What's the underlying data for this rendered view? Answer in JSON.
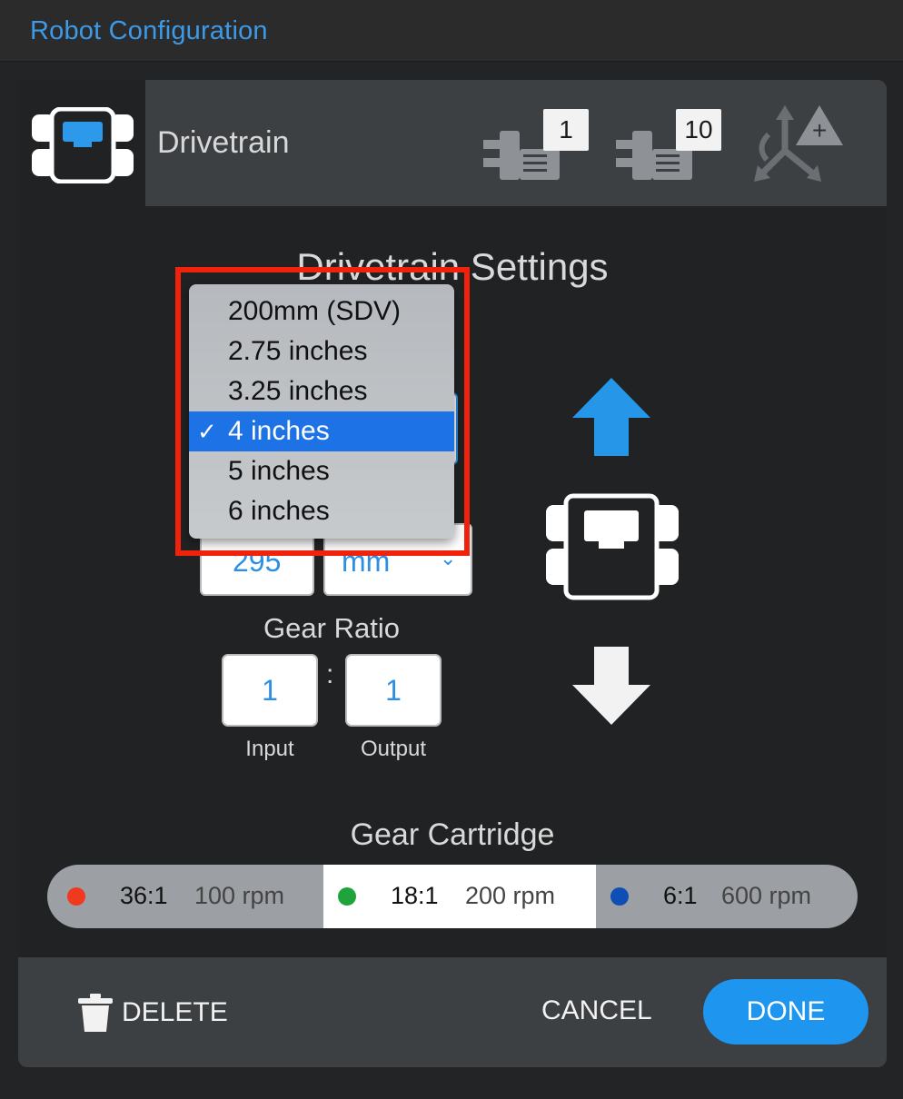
{
  "window": {
    "title": "Robot Configuration"
  },
  "header": {
    "device_label": "Drivetrain",
    "badges": [
      "1",
      "10",
      "+"
    ],
    "icons": [
      "drivetrain-icon",
      "motor-icon",
      "motor-group-icon",
      "inertial-sensor-icon"
    ]
  },
  "settings": {
    "title": "Drivetrain Settings",
    "wheel_size_options": [
      "200mm (SDV)",
      "2.75 inches",
      "3.25 inches",
      "4 inches",
      "5 inches",
      "6 inches"
    ],
    "wheel_size_selected": "4 inches",
    "selected_check": "✓",
    "wheelbase_value": "295",
    "wheelbase_unit": "mm",
    "gear_ratio": {
      "title": "Gear Ratio",
      "input_value": "1",
      "output_value": "1",
      "separator": ":",
      "input_caption": "Input",
      "output_caption": "Output"
    }
  },
  "cartridge": {
    "title": "Gear Cartridge",
    "options": [
      {
        "ratio": "36:1",
        "rpm": "100 rpm",
        "color": "#f0391e",
        "selected": false
      },
      {
        "ratio": "18:1",
        "rpm": "200 rpm",
        "color": "#1ea43a",
        "selected": true
      },
      {
        "ratio": "6:1",
        "rpm": "600 rpm",
        "color": "#0f4fb5",
        "selected": false
      }
    ]
  },
  "footer": {
    "delete_label": "DELETE",
    "cancel_label": "CANCEL",
    "done_label": "DONE"
  },
  "colors": {
    "accent": "#1e96f0",
    "title": "#3d9ae8",
    "highlight": "#f0220c",
    "arrow_up": "#2596e8",
    "arrow_down": "#f2f2f2"
  }
}
